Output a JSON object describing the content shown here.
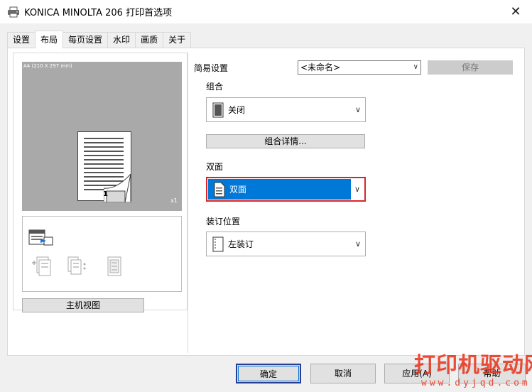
{
  "window": {
    "title": "KONICA MINOLTA 206 打印首选项",
    "close_label": "✕"
  },
  "tabs": [
    {
      "label": "设置",
      "active": false
    },
    {
      "label": "布局",
      "active": true
    },
    {
      "label": "每页设置",
      "active": false
    },
    {
      "label": "水印",
      "active": false
    },
    {
      "label": "画质",
      "active": false
    },
    {
      "label": "关于",
      "active": false
    }
  ],
  "preview": {
    "paper_label": "A4 (210 X 297 mm)",
    "copies_label": "x1",
    "page_number": "1"
  },
  "host_view_label": "主机视图",
  "easy_settings": {
    "label": "简易设置",
    "value": "<未命名>",
    "save_label": "保存"
  },
  "combination": {
    "label": "组合",
    "value": "关闭",
    "details_label": "组合详情..."
  },
  "duplex": {
    "label": "双面",
    "value": "双面"
  },
  "binding": {
    "label": "装订位置",
    "value": "左装订"
  },
  "buttons": {
    "ok": "确定",
    "cancel": "取消",
    "apply": "应用(A)",
    "help": "帮助"
  },
  "watermark": {
    "text": "打印机驱动网",
    "url": "www.dyjqd.com"
  },
  "colors": {
    "accent_blue": "#0078d7",
    "highlight_red": "#d6262b",
    "watermark_red": "#e8311a"
  }
}
